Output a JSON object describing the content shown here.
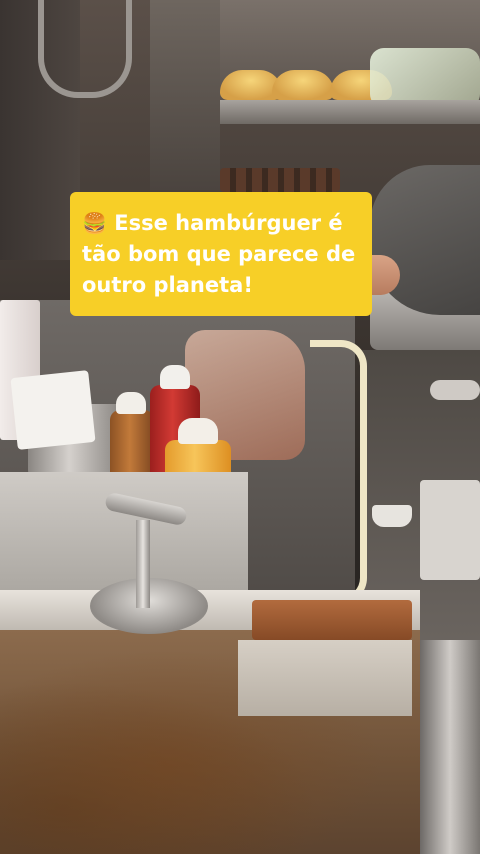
{
  "caption": {
    "icon": "burger-icon",
    "emoji": "🍔",
    "text": "Esse hambúrguer é tão bom que parece de outro planeta!"
  },
  "colors": {
    "caption_background": "#f7cf27",
    "caption_text": "#ffffff"
  }
}
